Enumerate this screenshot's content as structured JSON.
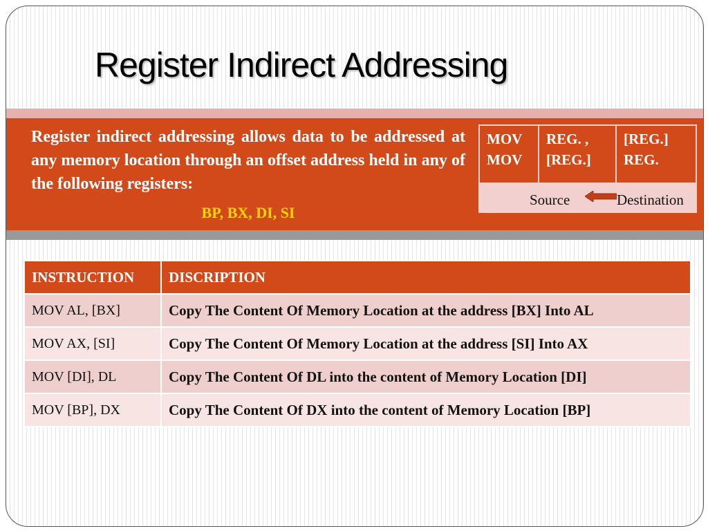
{
  "title": "Register Indirect Addressing",
  "intro": {
    "text": "Register indirect addressing allows data to be addressed at any memory location through an offset address held in any of the following registers:",
    "registers": "BP, BX, DI, SI"
  },
  "syntax_table": {
    "col1": [
      "MOV",
      "MOV"
    ],
    "col2": [
      "REG. ,",
      "[REG.]"
    ],
    "col3": [
      "[REG.]",
      "REG."
    ],
    "source_label": "Source",
    "destination_label": "Destination",
    "arrow_icon": "left-arrow-icon"
  },
  "instruction_table": {
    "headers": [
      "INSTRUCTION",
      "DISCRIPTION"
    ],
    "rows": [
      {
        "instruction": "MOV AL, [BX]",
        "description": "Copy The Content Of Memory Location at the address [BX] Into AL"
      },
      {
        "instruction": "MOV AX, [SI]",
        "description": "Copy The Content Of Memory Location at the address [SI] Into AX"
      },
      {
        "instruction": "MOV [DI], DL",
        "description": "Copy The Content Of DL into the content of Memory Location [DI]"
      },
      {
        "instruction": "MOV [BP], DX",
        "description": "Copy The Content Of DX into the content of Memory Location [BP]"
      }
    ]
  },
  "colors": {
    "accent": "#d24a1a",
    "highlight": "#ffd700",
    "band_pink": "#e8b0ac",
    "row_pink": "#efcfcd"
  }
}
